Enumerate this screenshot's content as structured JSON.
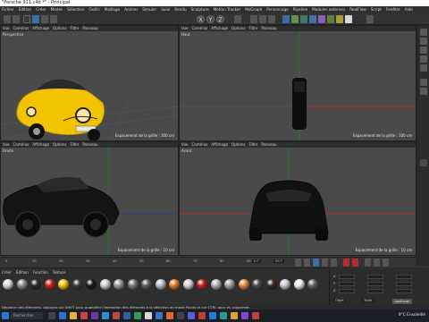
{
  "window": {
    "title": "\"Porsche 911.c4d *\" - Principal"
  },
  "menu": [
    "Fichier",
    "Édition",
    "Créer",
    "Modes",
    "Sélection",
    "Outils",
    "Maillage",
    "Animer",
    "Simuler",
    "Suivi",
    "Rendu",
    "Sculpture",
    "Motion Tracker",
    "MoGraph",
    "Personnage",
    "Pipeline",
    "Modules externes",
    "RealFlow",
    "Script",
    "Fenêtre",
    "Aide"
  ],
  "toolbar": {
    "axis_x": "X",
    "axis_y": "Y",
    "axis_z": "Z"
  },
  "viewports": {
    "perspective": {
      "menu": [
        "Vue",
        "Caméras",
        "Affichage",
        "Options",
        "Filtre",
        "Panneau"
      ],
      "label": "Perspective",
      "grid": "Espacement de la grille : 100 cm"
    },
    "top": {
      "menu": [
        "Vue",
        "Caméras",
        "Affichage",
        "Options",
        "Filtre",
        "Panneau"
      ],
      "label": "Haut",
      "grid": "Espacement de la grille : 100 cm"
    },
    "right": {
      "menu": [
        "Vue",
        "Caméras",
        "Affichage",
        "Options",
        "Filtre",
        "Panneau"
      ],
      "label": "Droite",
      "grid": "Espacement de la grille : 10 cm"
    },
    "front": {
      "menu": [
        "Vue",
        "Caméras",
        "Affichage",
        "Options",
        "Filtre",
        "Panneau"
      ],
      "label": "Avant",
      "grid": "Espacement de la grille : 10 cm"
    }
  },
  "timeline": {
    "ticks": [
      "0",
      "10",
      "20",
      "30",
      "40",
      "50",
      "60",
      "70",
      "80",
      "90"
    ],
    "frame_start": "0 F",
    "frame_end": "90 F"
  },
  "materials": {
    "menu": [
      "Créer",
      "Édition",
      "Fonction",
      "Texture"
    ]
  },
  "attributes": {
    "labels": [
      "X",
      "Y",
      "Z",
      "Objet",
      "Taille"
    ],
    "apply": "Appliquer"
  },
  "status": {
    "text": "Déplacer des éléments. Appuyez sur SHIFT pour quantifier l'animation des éléments à la sélection en mode Points et sur CTRL pour en supprimer."
  },
  "taskbar": {
    "search_placeholder": "Rechercher",
    "weather": "9°C  Ensoleillé"
  },
  "colors": {
    "car_yellow": "#f2c300",
    "grid_line": "#5a5a5a",
    "axis_green": "#2e7d32",
    "axis_red": "#c62828",
    "axis_blue": "#1e3fa0"
  }
}
